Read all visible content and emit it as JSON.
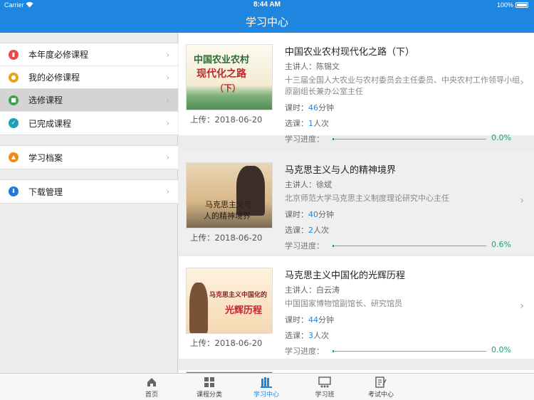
{
  "status_bar": {
    "carrier": "Carrier",
    "time": "8:44 AM",
    "battery": "100%"
  },
  "nav": {
    "title": "学习中心"
  },
  "sidebar": {
    "groups": [
      {
        "items": [
          {
            "label": "本年度必修课程",
            "color": "#e84a4a"
          },
          {
            "label": "我的必修课程",
            "color": "#e8a21a"
          },
          {
            "label": "选修课程",
            "color": "#3aa44a",
            "active": true
          },
          {
            "label": "已完成课程",
            "color": "#1f9fb8"
          }
        ]
      },
      {
        "items": [
          {
            "label": "学习档案",
            "color": "#f08a1a"
          }
        ]
      },
      {
        "items": [
          {
            "label": "下载管理",
            "color": "#1f7ad8"
          }
        ]
      }
    ]
  },
  "courses": [
    {
      "title": "中国农业农村现代化之路（下）",
      "lecturer": "主讲人：陈锡文",
      "desc": "十三届全国人大农业与农村委员会主任委员、中央农村工作领导小组原副组长兼办公室主任",
      "hours_prefix": "课时：",
      "hours_num": "46",
      "hours_unit": "分钟",
      "enroll_prefix": "选课：",
      "enroll_num": "1",
      "enroll_unit": "人次",
      "progress_label": "学习进度：",
      "progress": 0.0,
      "progress_text": "0.0%",
      "upload": "上传：2018-06-20",
      "thumb_text": [
        "中国农业农村",
        "现代化之路",
        "（下）"
      ]
    },
    {
      "title": "马克思主义与人的精神境界",
      "lecturer": "主讲人：徐斌",
      "desc": "北京师范大学马克思主义制度理论研究中心主任",
      "hours_prefix": "课时：",
      "hours_num": "40",
      "hours_unit": "分钟",
      "enroll_prefix": "选课：",
      "enroll_num": "2",
      "enroll_unit": "人次",
      "progress_label": "学习进度：",
      "progress": 0.6,
      "progress_text": "0.6%",
      "upload": "上传：2018-06-20",
      "thumb_text": [
        "马克思主义与",
        "人的精神境界"
      ]
    },
    {
      "title": "马克思主义中国化的光辉历程",
      "lecturer": "主讲人：白云涛",
      "desc": "中国国家博物馆副馆长、研究馆员",
      "hours_prefix": "课时：",
      "hours_num": "44",
      "hours_unit": "分钟",
      "enroll_prefix": "选课：",
      "enroll_num": "3",
      "enroll_unit": "人次",
      "progress_label": "学习进度：",
      "progress": 0.0,
      "progress_text": "0.0%",
      "upload": "上传：2018-06-20",
      "thumb_text": [
        "马克思主义中国化的",
        "光辉历程"
      ]
    },
    {
      "title": ""
    }
  ],
  "tabbar": {
    "tabs": [
      {
        "label": "首页",
        "icon": "home-icon"
      },
      {
        "label": "课程分类",
        "icon": "grid-icon"
      },
      {
        "label": "学习中心",
        "icon": "books-icon",
        "active": true
      },
      {
        "label": "学习班",
        "icon": "class-icon"
      },
      {
        "label": "考试中心",
        "icon": "exam-icon"
      }
    ]
  },
  "colors": {
    "primary": "#1f86e0",
    "progress": "#1aa36b"
  }
}
